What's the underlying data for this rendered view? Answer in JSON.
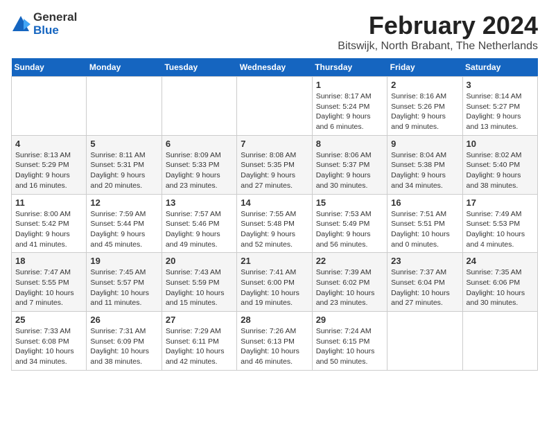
{
  "logo": {
    "line1": "General",
    "line2": "Blue"
  },
  "title": "February 2024",
  "subtitle": "Bitswijk, North Brabant, The Netherlands",
  "days_of_week": [
    "Sunday",
    "Monday",
    "Tuesday",
    "Wednesday",
    "Thursday",
    "Friday",
    "Saturday"
  ],
  "weeks": [
    [
      {
        "day": "",
        "info": ""
      },
      {
        "day": "",
        "info": ""
      },
      {
        "day": "",
        "info": ""
      },
      {
        "day": "",
        "info": ""
      },
      {
        "day": "1",
        "info": "Sunrise: 8:17 AM\nSunset: 5:24 PM\nDaylight: 9 hours\nand 6 minutes."
      },
      {
        "day": "2",
        "info": "Sunrise: 8:16 AM\nSunset: 5:26 PM\nDaylight: 9 hours\nand 9 minutes."
      },
      {
        "day": "3",
        "info": "Sunrise: 8:14 AM\nSunset: 5:27 PM\nDaylight: 9 hours\nand 13 minutes."
      }
    ],
    [
      {
        "day": "4",
        "info": "Sunrise: 8:13 AM\nSunset: 5:29 PM\nDaylight: 9 hours\nand 16 minutes."
      },
      {
        "day": "5",
        "info": "Sunrise: 8:11 AM\nSunset: 5:31 PM\nDaylight: 9 hours\nand 20 minutes."
      },
      {
        "day": "6",
        "info": "Sunrise: 8:09 AM\nSunset: 5:33 PM\nDaylight: 9 hours\nand 23 minutes."
      },
      {
        "day": "7",
        "info": "Sunrise: 8:08 AM\nSunset: 5:35 PM\nDaylight: 9 hours\nand 27 minutes."
      },
      {
        "day": "8",
        "info": "Sunrise: 8:06 AM\nSunset: 5:37 PM\nDaylight: 9 hours\nand 30 minutes."
      },
      {
        "day": "9",
        "info": "Sunrise: 8:04 AM\nSunset: 5:38 PM\nDaylight: 9 hours\nand 34 minutes."
      },
      {
        "day": "10",
        "info": "Sunrise: 8:02 AM\nSunset: 5:40 PM\nDaylight: 9 hours\nand 38 minutes."
      }
    ],
    [
      {
        "day": "11",
        "info": "Sunrise: 8:00 AM\nSunset: 5:42 PM\nDaylight: 9 hours\nand 41 minutes."
      },
      {
        "day": "12",
        "info": "Sunrise: 7:59 AM\nSunset: 5:44 PM\nDaylight: 9 hours\nand 45 minutes."
      },
      {
        "day": "13",
        "info": "Sunrise: 7:57 AM\nSunset: 5:46 PM\nDaylight: 9 hours\nand 49 minutes."
      },
      {
        "day": "14",
        "info": "Sunrise: 7:55 AM\nSunset: 5:48 PM\nDaylight: 9 hours\nand 52 minutes."
      },
      {
        "day": "15",
        "info": "Sunrise: 7:53 AM\nSunset: 5:49 PM\nDaylight: 9 hours\nand 56 minutes."
      },
      {
        "day": "16",
        "info": "Sunrise: 7:51 AM\nSunset: 5:51 PM\nDaylight: 10 hours\nand 0 minutes."
      },
      {
        "day": "17",
        "info": "Sunrise: 7:49 AM\nSunset: 5:53 PM\nDaylight: 10 hours\nand 4 minutes."
      }
    ],
    [
      {
        "day": "18",
        "info": "Sunrise: 7:47 AM\nSunset: 5:55 PM\nDaylight: 10 hours\nand 7 minutes."
      },
      {
        "day": "19",
        "info": "Sunrise: 7:45 AM\nSunset: 5:57 PM\nDaylight: 10 hours\nand 11 minutes."
      },
      {
        "day": "20",
        "info": "Sunrise: 7:43 AM\nSunset: 5:59 PM\nDaylight: 10 hours\nand 15 minutes."
      },
      {
        "day": "21",
        "info": "Sunrise: 7:41 AM\nSunset: 6:00 PM\nDaylight: 10 hours\nand 19 minutes."
      },
      {
        "day": "22",
        "info": "Sunrise: 7:39 AM\nSunset: 6:02 PM\nDaylight: 10 hours\nand 23 minutes."
      },
      {
        "day": "23",
        "info": "Sunrise: 7:37 AM\nSunset: 6:04 PM\nDaylight: 10 hours\nand 27 minutes."
      },
      {
        "day": "24",
        "info": "Sunrise: 7:35 AM\nSunset: 6:06 PM\nDaylight: 10 hours\nand 30 minutes."
      }
    ],
    [
      {
        "day": "25",
        "info": "Sunrise: 7:33 AM\nSunset: 6:08 PM\nDaylight: 10 hours\nand 34 minutes."
      },
      {
        "day": "26",
        "info": "Sunrise: 7:31 AM\nSunset: 6:09 PM\nDaylight: 10 hours\nand 38 minutes."
      },
      {
        "day": "27",
        "info": "Sunrise: 7:29 AM\nSunset: 6:11 PM\nDaylight: 10 hours\nand 42 minutes."
      },
      {
        "day": "28",
        "info": "Sunrise: 7:26 AM\nSunset: 6:13 PM\nDaylight: 10 hours\nand 46 minutes."
      },
      {
        "day": "29",
        "info": "Sunrise: 7:24 AM\nSunset: 6:15 PM\nDaylight: 10 hours\nand 50 minutes."
      },
      {
        "day": "",
        "info": ""
      },
      {
        "day": "",
        "info": ""
      }
    ]
  ]
}
